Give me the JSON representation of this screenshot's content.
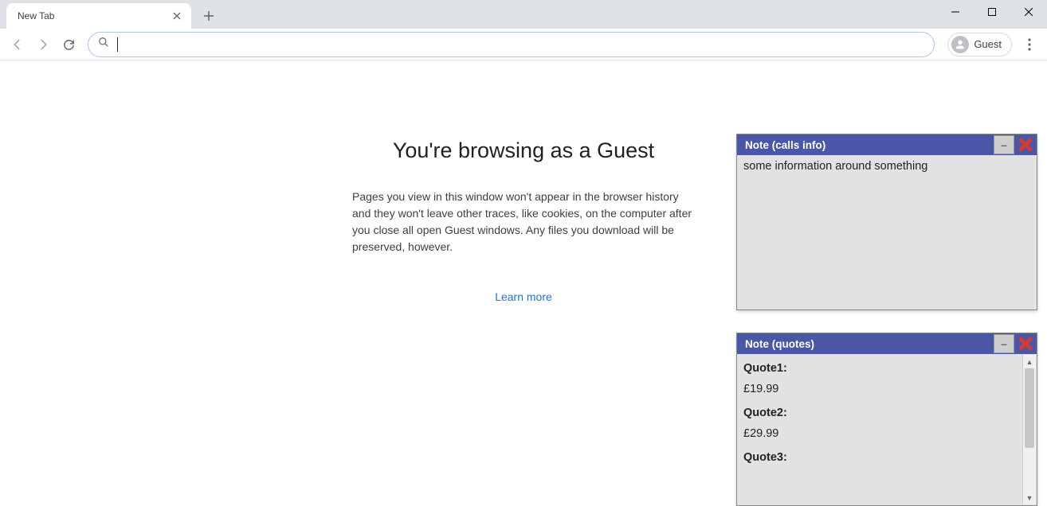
{
  "tab": {
    "title": "New Tab"
  },
  "profile": {
    "label": "Guest"
  },
  "omnibox": {
    "value": ""
  },
  "guest": {
    "title": "You're browsing as a Guest",
    "text": "Pages you view in this window won't appear in the browser history and they won't leave other traces, like cookies, on the computer after you close all open Guest windows. Any files you download will be preserved, however.",
    "learn_more": "Learn more"
  },
  "notes": [
    {
      "title": "Note (calls info)",
      "body": "some information around something"
    },
    {
      "title": "Note (quotes)",
      "quotes": [
        {
          "label": "Quote1:",
          "value": "£19.99"
        },
        {
          "label": "Quote2:",
          "value": "£29.99"
        },
        {
          "label": "Quote3:",
          "value": ""
        }
      ]
    }
  ]
}
